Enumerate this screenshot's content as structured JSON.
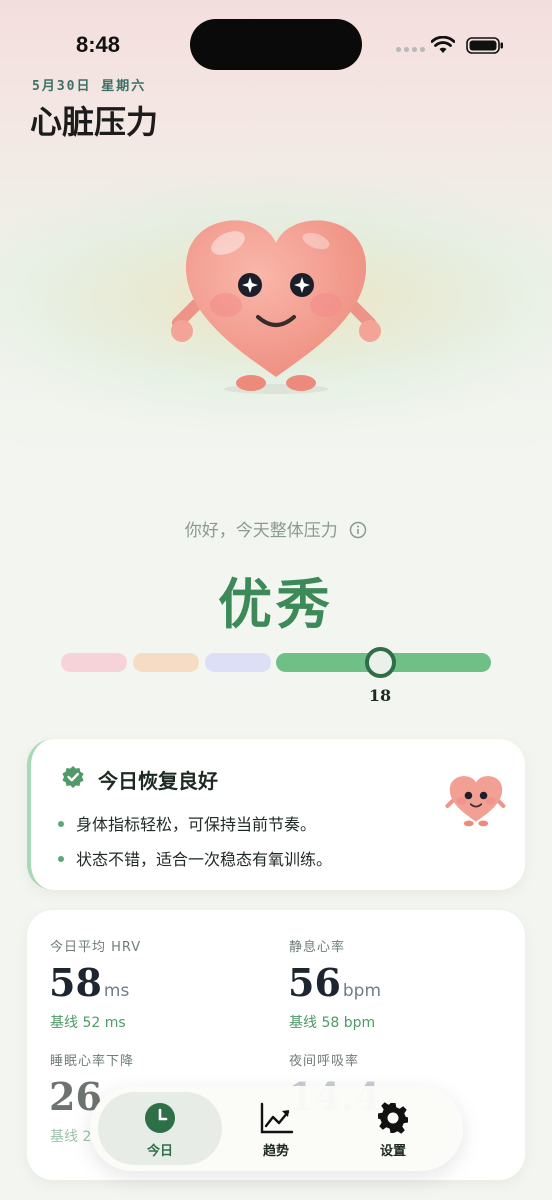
{
  "status_bar": {
    "time": "8:48"
  },
  "header": {
    "date": "5月30日 星期六",
    "title": "心脏压力"
  },
  "summary": {
    "greeting": "你好，今天整体压力",
    "level": "优秀",
    "score": "18",
    "score_fraction": 0.18
  },
  "recovery_card": {
    "title": "今日恢复良好",
    "bullets": [
      "身体指标轻松，可保持当前节奏。",
      "状态不错，适合一次稳态有氧训练。"
    ]
  },
  "metrics": [
    {
      "label": "今日平均 HRV",
      "value": "58",
      "unit": "ms",
      "baseline": "基线 52 ms"
    },
    {
      "label": "静息心率",
      "value": "56",
      "unit": "bpm",
      "baseline": "基线 58 bpm"
    },
    {
      "label": "睡眠心率下降",
      "value": "26",
      "unit": "",
      "baseline": "基线 2"
    },
    {
      "label": "夜间呼吸率",
      "value": "14.4",
      "unit": "",
      "baseline": ""
    }
  ],
  "tabs": [
    {
      "label": "今日",
      "icon": "clock-icon",
      "active": true
    },
    {
      "label": "趋势",
      "icon": "trend-chart-icon",
      "active": false
    },
    {
      "label": "设置",
      "icon": "gear-icon",
      "active": false
    }
  ],
  "colors": {
    "accent": "#3d8a59",
    "score_track": "#6fbf87",
    "heart": "#f2a094"
  }
}
